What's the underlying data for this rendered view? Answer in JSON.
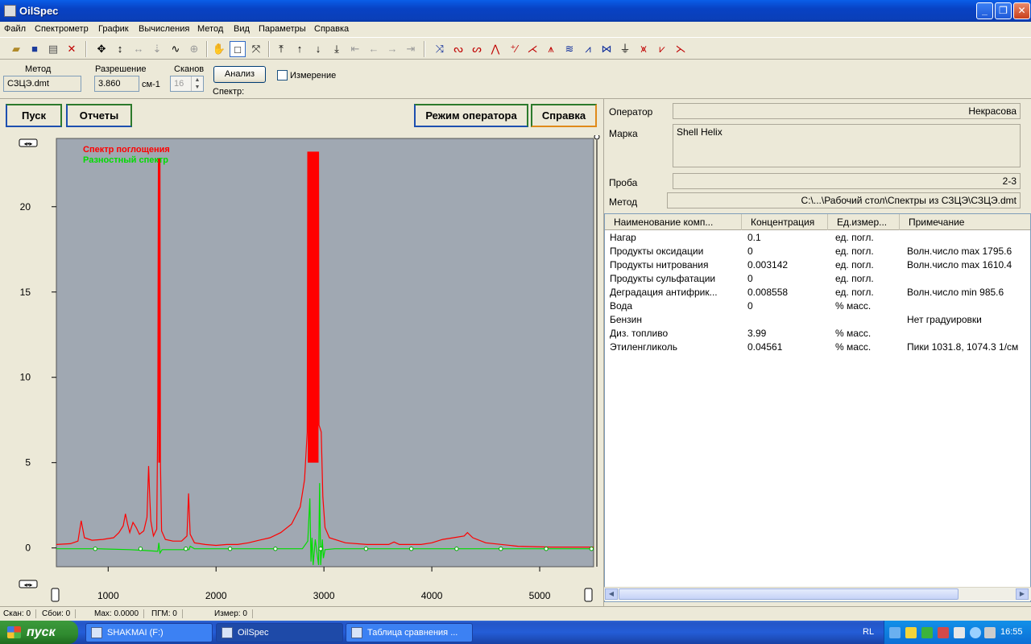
{
  "window": {
    "title": "OilSpec"
  },
  "menu": [
    "Файл",
    "Спектрометр",
    "График",
    "Вычисления",
    "Метод",
    "Вид",
    "Параметры",
    "Справка"
  ],
  "params": {
    "method_label": "Метод",
    "method_value": "СЗЦЭ.dmt",
    "resolution_label": "Разрешение",
    "resolution_value": "3.860",
    "resolution_unit": "см-1",
    "scans_label": "Сканов",
    "scans_value": "16",
    "analyze_button": "Анализ",
    "measure_checkbox": "Измерение",
    "spectrum_label": "Спектр:"
  },
  "buttons": {
    "start": "Пуск",
    "reports": "Отчеты",
    "operator_mode": "Режим оператора",
    "help": "Справка"
  },
  "info": {
    "operator_label": "Оператор",
    "operator_value": "Некрасова",
    "brand_label": "Марка",
    "brand_value": "Shell Helix",
    "sample_label": "Проба",
    "sample_value": "2-3",
    "method_label": "Метод",
    "method_value": "C:\\...\\Рабочий стол\\Спектры из СЗЦЭ\\СЗЦЭ.dmt"
  },
  "table": {
    "columns": [
      "Наименование комп...",
      "Концентрация",
      "Ед.измер...",
      "Примечание"
    ],
    "rows": [
      [
        "Нагар",
        "0.1",
        "ед. погл.",
        ""
      ],
      [
        "Продукты оксидации",
        "0",
        "ед. погл.",
        "Волн.число max 1795.6"
      ],
      [
        "Продукты нитрования",
        "0.003142",
        "ед. погл.",
        "Волн.число max 1610.4"
      ],
      [
        "Продукты сульфатации",
        "0",
        "ед. погл.",
        ""
      ],
      [
        "Деградация антифрик...",
        "0.008558",
        "ед. погл.",
        "Волн.число min 985.6"
      ],
      [
        "Вода",
        "0",
        "% масс.",
        ""
      ],
      [
        "Бензин",
        "",
        "",
        "Нет градуировки"
      ],
      [
        "Диз. топливо",
        "3.99",
        "% масс.",
        ""
      ],
      [
        "Этиленгликоль",
        "0.04561",
        "% масс.",
        "Пики 1031.8, 1074.3 1/см"
      ]
    ]
  },
  "statusbar": [
    "Скан: 0",
    "Сбои: 0",
    "Max: 0.0000",
    "ПГМ: 0",
    "Измер: 0"
  ],
  "taskbar": {
    "start": "пуск",
    "tasks": [
      "SHAKMAI (F:)",
      "OilSpec",
      "Таблица  сравнения ..."
    ],
    "lang": "RL",
    "clock": "16:55"
  },
  "colors": {
    "absorption": "#ff0000",
    "difference": "#00dd00",
    "plot_bg": "#a0a8b2"
  },
  "chart_data": {
    "type": "line",
    "xlim": [
      520,
      5500
    ],
    "ylim": [
      -1.1,
      24
    ],
    "x_ticks": [
      1000,
      2000,
      3000,
      4000,
      5000
    ],
    "y_ticks": [
      0,
      5,
      10,
      15,
      20
    ],
    "series": [
      {
        "name": "Спектр поглощения",
        "color": "#ff0000",
        "points": [
          [
            520,
            0.2
          ],
          [
            650,
            0.25
          ],
          [
            720,
            0.4
          ],
          [
            750,
            1.6
          ],
          [
            780,
            0.6
          ],
          [
            850,
            0.45
          ],
          [
            950,
            0.5
          ],
          [
            1000,
            0.55
          ],
          [
            1050,
            0.6
          ],
          [
            1100,
            0.9
          ],
          [
            1140,
            1.3
          ],
          [
            1160,
            2.0
          ],
          [
            1180,
            1.4
          ],
          [
            1200,
            0.9
          ],
          [
            1230,
            1.5
          ],
          [
            1260,
            1.2
          ],
          [
            1290,
            0.8
          ],
          [
            1330,
            1.0
          ],
          [
            1360,
            1.8
          ],
          [
            1375,
            4.8
          ],
          [
            1385,
            3.0
          ],
          [
            1395,
            1.6
          ],
          [
            1420,
            0.7
          ],
          [
            1450,
            1.1
          ],
          [
            1460,
            8
          ],
          [
            1465,
            22.8
          ],
          [
            1480,
            22.8
          ],
          [
            1485,
            5
          ],
          [
            1495,
            1.0
          ],
          [
            1530,
            0.5
          ],
          [
            1600,
            0.4
          ],
          [
            1680,
            0.4
          ],
          [
            1730,
            0.7
          ],
          [
            1745,
            3.2
          ],
          [
            1760,
            0.8
          ],
          [
            1800,
            0.3
          ],
          [
            1900,
            0.2
          ],
          [
            2000,
            0.15
          ],
          [
            2100,
            0.2
          ],
          [
            2200,
            0.2
          ],
          [
            2300,
            0.3
          ],
          [
            2400,
            0.45
          ],
          [
            2500,
            0.6
          ],
          [
            2600,
            0.9
          ],
          [
            2700,
            1.4
          ],
          [
            2780,
            2.4
          ],
          [
            2820,
            4.0
          ],
          [
            2845,
            6.8
          ],
          [
            2850,
            23.2
          ],
          [
            2950,
            23.2
          ],
          [
            2955,
            7.2
          ],
          [
            2975,
            6.8
          ],
          [
            2990,
            3.0
          ],
          [
            3010,
            1.2
          ],
          [
            3050,
            0.6
          ],
          [
            3200,
            0.3
          ],
          [
            3400,
            0.2
          ],
          [
            3600,
            0.2
          ],
          [
            3650,
            0.35
          ],
          [
            3700,
            0.2
          ],
          [
            3900,
            0.2
          ],
          [
            4000,
            0.3
          ],
          [
            4100,
            0.5
          ],
          [
            4200,
            0.6
          ],
          [
            4300,
            0.7
          ],
          [
            4330,
            0.9
          ],
          [
            4380,
            0.6
          ],
          [
            4500,
            0.3
          ],
          [
            4800,
            0.1
          ],
          [
            5100,
            0.05
          ],
          [
            5500,
            0.05
          ]
        ]
      },
      {
        "name": "Разностный спектр",
        "color": "#00dd00",
        "points": [
          [
            520,
            -0.05
          ],
          [
            900,
            -0.05
          ],
          [
            1200,
            -0.1
          ],
          [
            1350,
            -0.15
          ],
          [
            1460,
            -0.2
          ],
          [
            1470,
            0.3
          ],
          [
            1480,
            -0.3
          ],
          [
            1500,
            -0.1
          ],
          [
            1750,
            -0.1
          ],
          [
            1760,
            0.1
          ],
          [
            1800,
            -0.05
          ],
          [
            2500,
            -0.05
          ],
          [
            2800,
            -0.05
          ],
          [
            2850,
            0.4
          ],
          [
            2870,
            2.9
          ],
          [
            2880,
            -0.8
          ],
          [
            2890,
            0.6
          ],
          [
            2900,
            -1.0
          ],
          [
            2920,
            0.5
          ],
          [
            2950,
            -1.0
          ],
          [
            2960,
            3.8
          ],
          [
            2970,
            -1.0
          ],
          [
            2985,
            0.5
          ],
          [
            2995,
            -0.6
          ],
          [
            3010,
            -0.1
          ],
          [
            3100,
            -0.05
          ],
          [
            5500,
            -0.05
          ]
        ]
      }
    ],
    "green_markers_x": [
      880,
      1300,
      1720,
      2130,
      2550,
      2970,
      3390,
      3810,
      4230,
      4640,
      5060,
      5480
    ]
  }
}
